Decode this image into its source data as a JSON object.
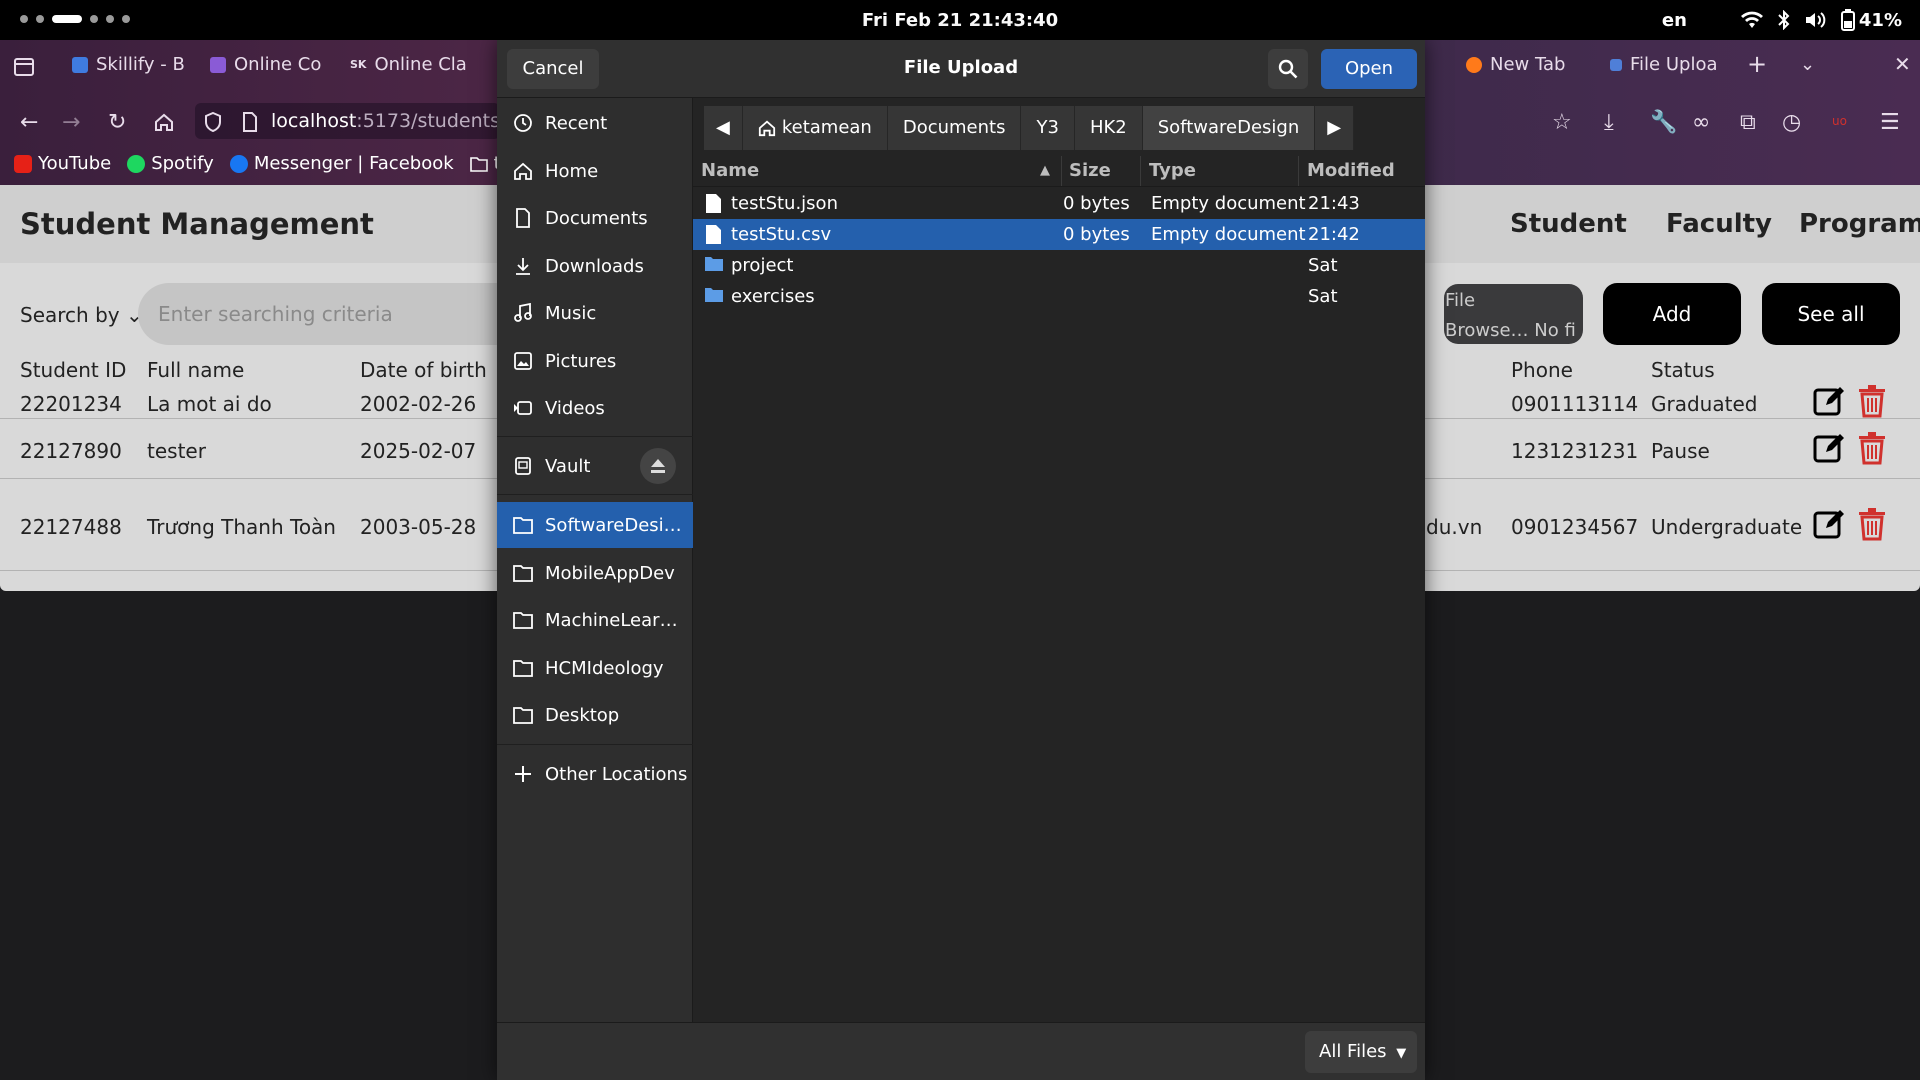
{
  "topbar": {
    "clock": "Fri Feb 21  21:43:40",
    "lang": "en",
    "battery": "41%"
  },
  "browser": {
    "tabs": [
      "Skillify - B",
      "Online Co",
      "Online Cla",
      "New Tab",
      "File Uploa"
    ],
    "tab_badge": "SK",
    "url_host": "localhost",
    "url_path": ":5173/students",
    "bookmarks": [
      "YouTube",
      "Spotify",
      "Messenger | Facebook",
      "this"
    ]
  },
  "page": {
    "title": "Student Management",
    "nav": [
      "Student",
      "Faculty",
      "Program"
    ],
    "search_by": "Search by",
    "search_placeholder": "Enter searching criteria",
    "file_input_line1": "File",
    "file_input_line2": "Browse… No fi",
    "add_label": "Add",
    "see_all_label": "See all",
    "columns": {
      "id": "Student ID",
      "name": "Full name",
      "dob": "Date of birth",
      "phone": "Phone",
      "status": "Status"
    },
    "rows": [
      {
        "id": "22201234",
        "name": "La mot ai do",
        "dob": "2002-02-26",
        "email_tail": "",
        "phone": "0901113114",
        "status": "Graduated"
      },
      {
        "id": "22127890",
        "name": "tester",
        "dob": "2025-02-07",
        "email_tail": "",
        "phone": "1231231231",
        "status": "Pause"
      },
      {
        "id": "22127488",
        "name": "Trương Thanh Toàn",
        "dob": "2003-05-28",
        "email_tail": "du.vn",
        "phone": "0901234567",
        "status": "Undergraduate"
      }
    ]
  },
  "dialog": {
    "title": "File Upload",
    "cancel": "Cancel",
    "open": "Open",
    "sidebar": {
      "places": [
        "Recent",
        "Home",
        "Documents",
        "Downloads",
        "Music",
        "Pictures",
        "Videos"
      ],
      "vault": "Vault",
      "bookmarks": [
        "SoftwareDesi…",
        "MobileAppDev",
        "MachineLear…",
        "HCMIdeology",
        "Desktop"
      ],
      "other": "Other Locations"
    },
    "path": [
      "ketamean",
      "Documents",
      "Y3",
      "HK2",
      "SoftwareDesign"
    ],
    "columns": {
      "name": "Name",
      "size": "Size",
      "type": "Type",
      "modified": "Modified"
    },
    "files": [
      {
        "name": "testStu.json",
        "size": "0 bytes",
        "type": "Empty document",
        "modified": "21:43",
        "kind": "file"
      },
      {
        "name": "testStu.csv",
        "size": "0 bytes",
        "type": "Empty document",
        "modified": "21:42",
        "kind": "file"
      },
      {
        "name": "project",
        "size": "",
        "type": "",
        "modified": "Sat",
        "kind": "folder"
      },
      {
        "name": "exercises",
        "size": "",
        "type": "",
        "modified": "Sat",
        "kind": "folder"
      }
    ],
    "filter": "All Files"
  },
  "colors": {
    "accent": "#2460ad",
    "open_button": "#2b63b5",
    "delete": "#d0312d"
  }
}
